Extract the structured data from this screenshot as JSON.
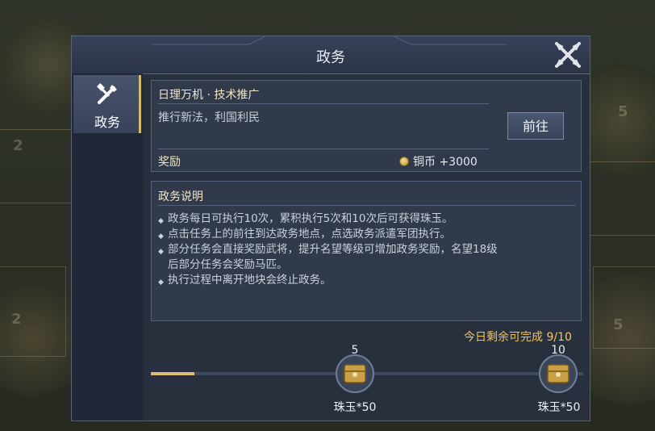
{
  "map": {
    "tile_numbers": [
      "2",
      "5",
      "2",
      "5"
    ]
  },
  "dialog": {
    "title": "政务",
    "side_tab_label": "政务"
  },
  "task": {
    "title": "日理万机 · 技术推广",
    "description": "推行新法，利国利民",
    "goto_label": "前往",
    "reward_label": "奖励",
    "reward_value": "铜币 +3000"
  },
  "rules": {
    "title": "政务说明",
    "items": [
      "政务每日可执行10次，累积执行5次和10次后可获得珠玉。",
      "点击任务上的前往到达政务地点，点选政务派遣军团执行。",
      "部分任务会直接奖励武将，提升名望等级可增加政务奖励，名望18级",
      "后部分任务会奖励马匹。",
      "执行过程中离开地块会终止政务。"
    ]
  },
  "progress": {
    "remaining_label": "今日剩余可完成 9/10",
    "completed": 1,
    "total": 10,
    "milestones": [
      {
        "count": "5",
        "reward": "珠玉*50"
      },
      {
        "count": "10",
        "reward": "珠玉*50"
      }
    ]
  },
  "colors": {
    "accent": "#f4c35a",
    "tab_border": "#d7bb6c",
    "panel": "#303a4b"
  }
}
